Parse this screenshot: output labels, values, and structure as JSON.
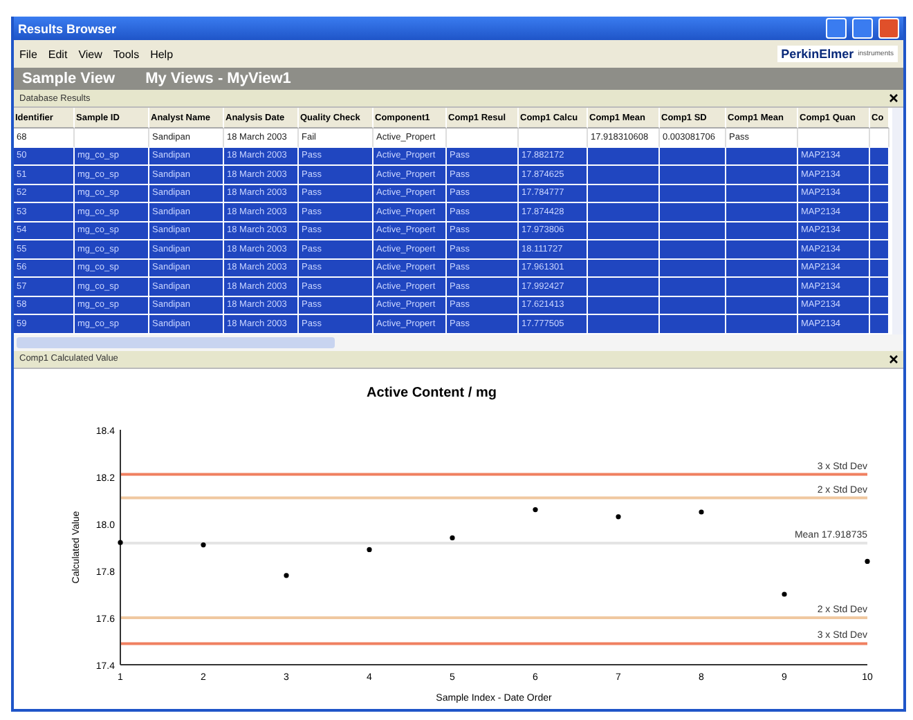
{
  "window": {
    "title": "Results Browser"
  },
  "menu": [
    "File",
    "Edit",
    "View",
    "Tools",
    "Help"
  ],
  "logo": {
    "name": "PerkinElmer",
    "tagline": "instruments"
  },
  "view_bar": {
    "title": "Sample View",
    "subtitle": "My Views - MyView1"
  },
  "results_pane": {
    "title": "Database Results",
    "columns": [
      "Identifier",
      "Sample ID",
      "Analyst Name",
      "Analysis Date",
      "Quality Check",
      "Component1",
      "Comp1 Resul",
      "Comp1 Calcu",
      "Comp1 Mean",
      "Comp1 SD",
      "Comp1 Mean",
      "Comp1 Quan",
      "Co"
    ],
    "rows": [
      {
        "selected": false,
        "cells": [
          "68",
          "",
          "Sandipan",
          "18 March 2003",
          "Fail",
          "Active_Propert",
          "",
          "",
          "17.918310608",
          "0.003081706",
          "Pass",
          "",
          ""
        ]
      },
      {
        "selected": true,
        "cells": [
          "50",
          "mg_co_sp",
          "Sandipan",
          "18 March 2003",
          "Pass",
          "Active_Propert",
          "Pass",
          "17.882172",
          "",
          "",
          "",
          "MAP2134",
          ""
        ]
      },
      {
        "selected": true,
        "cells": [
          "51",
          "mg_co_sp",
          "Sandipan",
          "18 March 2003",
          "Pass",
          "Active_Propert",
          "Pass",
          "17.874625",
          "",
          "",
          "",
          "MAP2134",
          ""
        ]
      },
      {
        "selected": true,
        "cells": [
          "52",
          "mg_co_sp",
          "Sandipan",
          "18 March 2003",
          "Pass",
          "Active_Propert",
          "Pass",
          "17.784777",
          "",
          "",
          "",
          "MAP2134",
          ""
        ]
      },
      {
        "selected": true,
        "cells": [
          "53",
          "mg_co_sp",
          "Sandipan",
          "18 March 2003",
          "Pass",
          "Active_Propert",
          "Pass",
          "17.874428",
          "",
          "",
          "",
          "MAP2134",
          ""
        ]
      },
      {
        "selected": true,
        "cells": [
          "54",
          "mg_co_sp",
          "Sandipan",
          "18 March 2003",
          "Pass",
          "Active_Propert",
          "Pass",
          "17.973806",
          "",
          "",
          "",
          "MAP2134",
          ""
        ]
      },
      {
        "selected": true,
        "cells": [
          "55",
          "mg_co_sp",
          "Sandipan",
          "18 March 2003",
          "Pass",
          "Active_Propert",
          "Pass",
          "18.111727",
          "",
          "",
          "",
          "MAP2134",
          ""
        ]
      },
      {
        "selected": true,
        "cells": [
          "56",
          "mg_co_sp",
          "Sandipan",
          "18 March 2003",
          "Pass",
          "Active_Propert",
          "Pass",
          "17.961301",
          "",
          "",
          "",
          "MAP2134",
          ""
        ]
      },
      {
        "selected": true,
        "cells": [
          "57",
          "mg_co_sp",
          "Sandipan",
          "18 March 2003",
          "Pass",
          "Active_Propert",
          "Pass",
          "17.992427",
          "",
          "",
          "",
          "MAP2134",
          ""
        ]
      },
      {
        "selected": true,
        "cells": [
          "58",
          "mg_co_sp",
          "Sandipan",
          "18 March 2003",
          "Pass",
          "Active_Propert",
          "Pass",
          "17.621413",
          "",
          "",
          "",
          "MAP2134",
          ""
        ]
      },
      {
        "selected": true,
        "cells": [
          "59",
          "mg_co_sp",
          "Sandipan",
          "18 March 2003",
          "Pass",
          "Active_Propert",
          "Pass",
          "17.777505",
          "",
          "",
          "",
          "MAP2134",
          ""
        ]
      }
    ]
  },
  "chart_pane": {
    "title": "Comp1 Calculated Value",
    "chart_data": {
      "type": "scatter",
      "title": "Active Content / mg",
      "xlabel": "Sample Index - Date Order",
      "ylabel": "Calculated Value",
      "x": [
        1,
        2,
        3,
        4,
        5,
        6,
        7,
        8,
        9,
        10
      ],
      "series": [
        {
          "color": "#000000",
          "values": [
            17.92,
            17.91,
            17.78,
            17.89,
            17.94,
            18.06,
            18.03,
            18.05,
            17.7,
            17.84
          ]
        }
      ],
      "xlim": [
        1,
        10
      ],
      "ylim": [
        17.4,
        18.4
      ],
      "xticks": [
        1,
        2,
        3,
        4,
        5,
        6,
        7,
        8,
        9,
        10
      ],
      "yticks": [
        17.4,
        17.6,
        17.8,
        {
          "value": 18,
          "label": "18.0"
        },
        18.2,
        18.4
      ],
      "ref_lines": [
        {
          "axis": "y",
          "label": "3 x Std Dev",
          "value": 18.21,
          "color": "#f08060"
        },
        {
          "axis": "y",
          "label": "2 x Std Dev",
          "value": 18.11,
          "color": "#f0c8a0"
        },
        {
          "axis": "y",
          "label": "Mean 17.918735",
          "value": 17.918,
          "color": "#e4e4e4"
        },
        {
          "axis": "y",
          "label": "2 x Std Dev",
          "value": 17.6,
          "color": "#f0c8a0"
        },
        {
          "axis": "y",
          "label": "3 x Std Dev",
          "value": 17.49,
          "color": "#f08060"
        }
      ]
    }
  }
}
